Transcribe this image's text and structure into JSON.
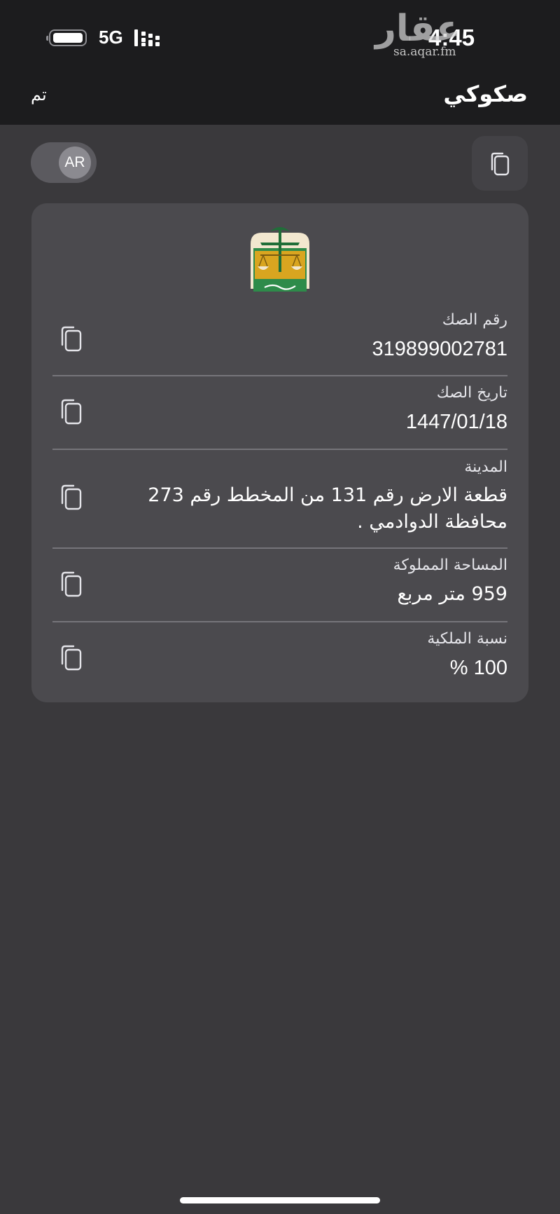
{
  "status_bar": {
    "network": "5G",
    "time": "4:45"
  },
  "watermark": {
    "word": "عقار",
    "url": "sa.aqar.fm"
  },
  "nav": {
    "title": "صكوكي",
    "done_label": "تم"
  },
  "language_toggle": {
    "label": "AR"
  },
  "deed": {
    "fields": [
      {
        "label": "رقم الصك",
        "value": "319899002781"
      },
      {
        "label": "تاريخ الصك",
        "value": "1447/01/18"
      },
      {
        "label": "المدينة",
        "value": "قطعة الارض  رقم 131 من المخطط رقم  273 محافظة الدوادمي ."
      },
      {
        "label": "المساحة المملوكة",
        "value": "959 متر مربع"
      },
      {
        "label": "نسبة الملكية",
        "value": "100 %"
      }
    ]
  },
  "colors": {
    "background": "#3a393c",
    "bar": "#1c1c1e",
    "card": "#4b4a4e",
    "emblem_green": "#2e8b4a",
    "emblem_gold": "#d9a520"
  }
}
